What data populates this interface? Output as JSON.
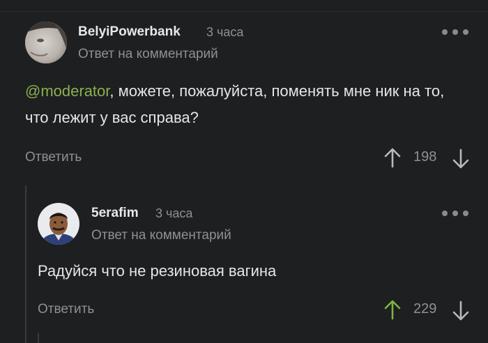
{
  "comments": [
    {
      "username": "BelyiPowerbank",
      "time": "3 часа",
      "subtitle": "Ответ на комментарий",
      "mention": "@moderator",
      "text": ", можете, пожалуйста, поменять мне ник на то, что лежит у вас справа?",
      "reply_label": "Ответить",
      "score": "198",
      "upvoted": false
    },
    {
      "username": "5erafim",
      "time": "3 часа",
      "subtitle": "Ответ на комментарий",
      "text": "Радуйся что не резиновая вагина",
      "reply_label": "Ответить",
      "score": "229",
      "upvoted": true
    }
  ],
  "colors": {
    "background": "#1e1f20",
    "mention": "#8bb04f",
    "upvote_active": "#7fb541",
    "muted": "#8f9092"
  }
}
